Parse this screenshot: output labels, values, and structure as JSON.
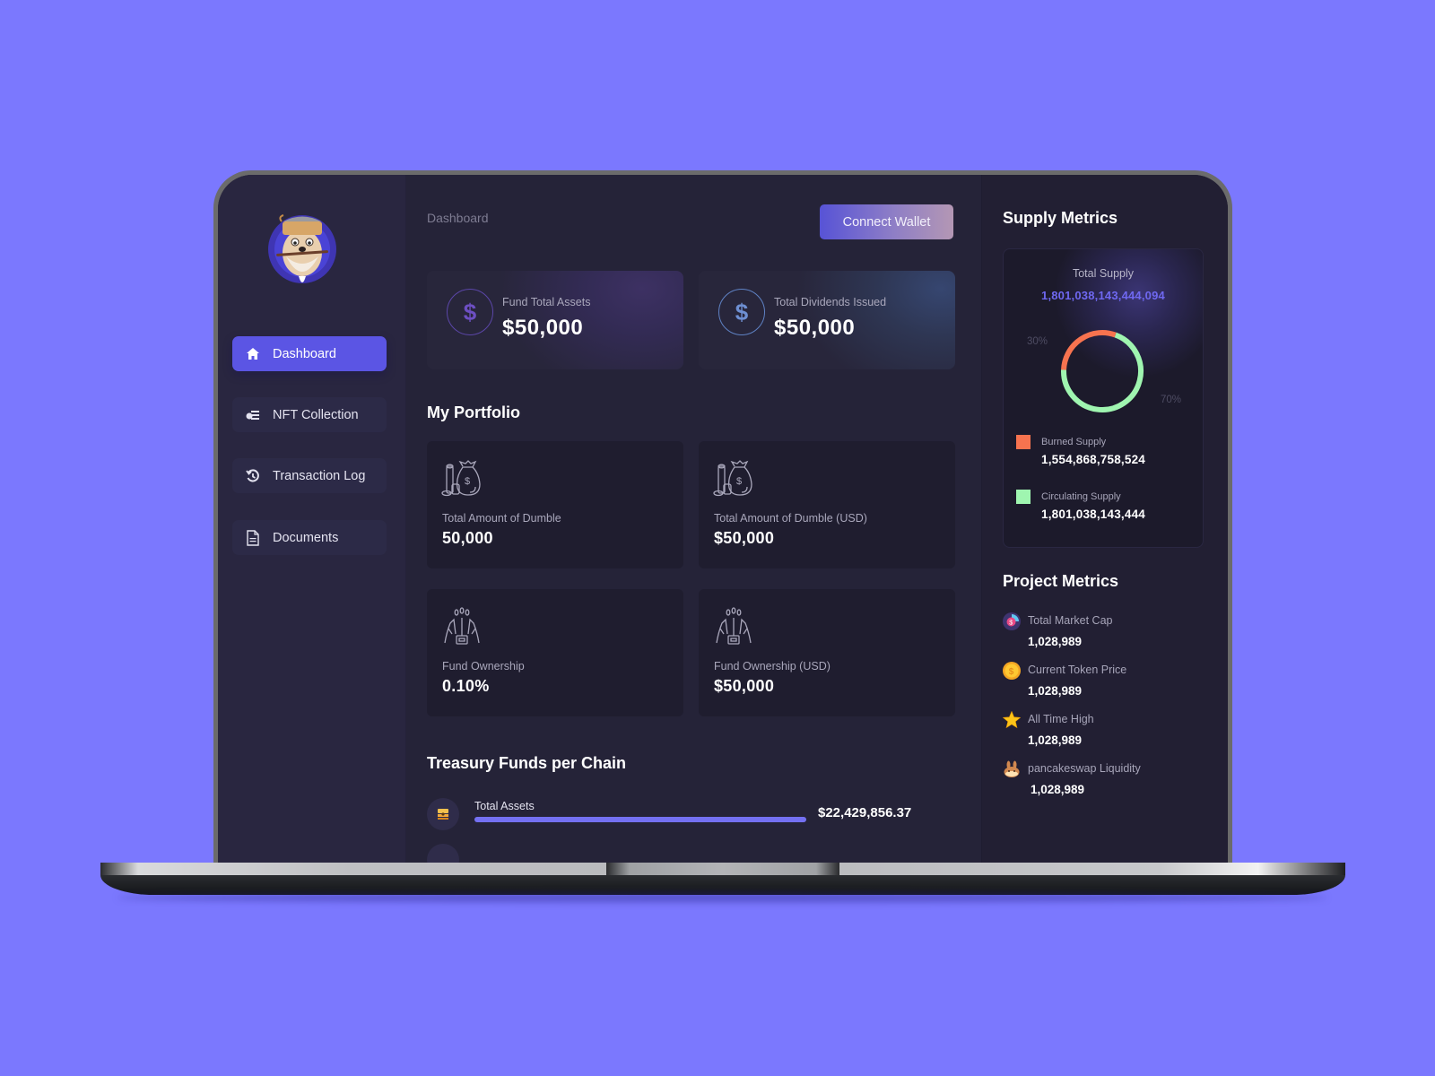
{
  "sidebar": {
    "items": [
      {
        "label": "Dashboard",
        "icon": "home-icon",
        "active": true
      },
      {
        "label": "NFT Collection",
        "icon": "nft-collection-icon",
        "active": false
      },
      {
        "label": "Transaction Log",
        "icon": "history-icon",
        "active": false
      },
      {
        "label": "Documents",
        "icon": "document-icon",
        "active": false
      }
    ]
  },
  "header": {
    "breadcrumb": "Dashboard",
    "connect_wallet_label": "Connect Wallet"
  },
  "stats": [
    {
      "label": "Fund Total Assets",
      "value": "$50,000",
      "icon": "dollar-icon",
      "symbol": "$"
    },
    {
      "label": "Total Dividends Issued",
      "value": "$50,000",
      "icon": "dollar-icon",
      "symbol": "$"
    }
  ],
  "portfolio": {
    "title": "My Portfolio",
    "cards": [
      {
        "label": "Total Amount of Dumble",
        "value": "50,000",
        "icon": "money-bag-icon"
      },
      {
        "label": "Total Amount of Dumble (USD)",
        "value": "$50,000",
        "icon": "money-bag-icon"
      },
      {
        "label": "Fund Ownership",
        "value": "0.10%",
        "icon": "ownership-hands-icon"
      },
      {
        "label": "Fund Ownership (USD)",
        "value": "$50,000",
        "icon": "ownership-hands-icon"
      }
    ]
  },
  "treasury": {
    "title": "Treasury Funds per Chain",
    "rows": [
      {
        "label": "Total Assets",
        "value": "$22,429,856.37",
        "progress_percent": 100,
        "icon": "treasure-chest-icon"
      }
    ]
  },
  "supply_metrics": {
    "title": "Supply Metrics",
    "total_supply_label": "Total Supply",
    "total_supply_value": "1,801,038,143,444,094",
    "colors": {
      "burned": "#f7734f",
      "circulating": "#9ff5b0",
      "accent": "#6f68f0"
    },
    "burned_percent_label": "30%",
    "circulating_percent_label": "70%",
    "legend": [
      {
        "label": "Burned Supply",
        "value": "1,554,868,758,524",
        "color": "#f7734f"
      },
      {
        "label": "Circulating Supply",
        "value": "1,801,038,143,444",
        "color": "#9ff5b0"
      }
    ]
  },
  "chart_data": {
    "type": "pie",
    "title": "Total Supply",
    "categories": [
      "Burned Supply",
      "Circulating Supply"
    ],
    "values": [
      30,
      70
    ],
    "colors": [
      "#f7734f",
      "#9ff5b0"
    ],
    "donut": true,
    "legend_placement": "bottom"
  },
  "project_metrics": {
    "title": "Project Metrics",
    "items": [
      {
        "label": "Total Market Cap",
        "value": "1,028,989",
        "icon": "market-cap-icon"
      },
      {
        "label": "Current Token Price",
        "value": "1,028,989",
        "icon": "coin-icon"
      },
      {
        "label": "All Time High",
        "value": "1,028,989",
        "icon": "star-icon"
      },
      {
        "label": "pancakeswap  Liquidity",
        "value": "1,028,989",
        "icon": "pancakeswap-bunny-icon"
      }
    ]
  }
}
